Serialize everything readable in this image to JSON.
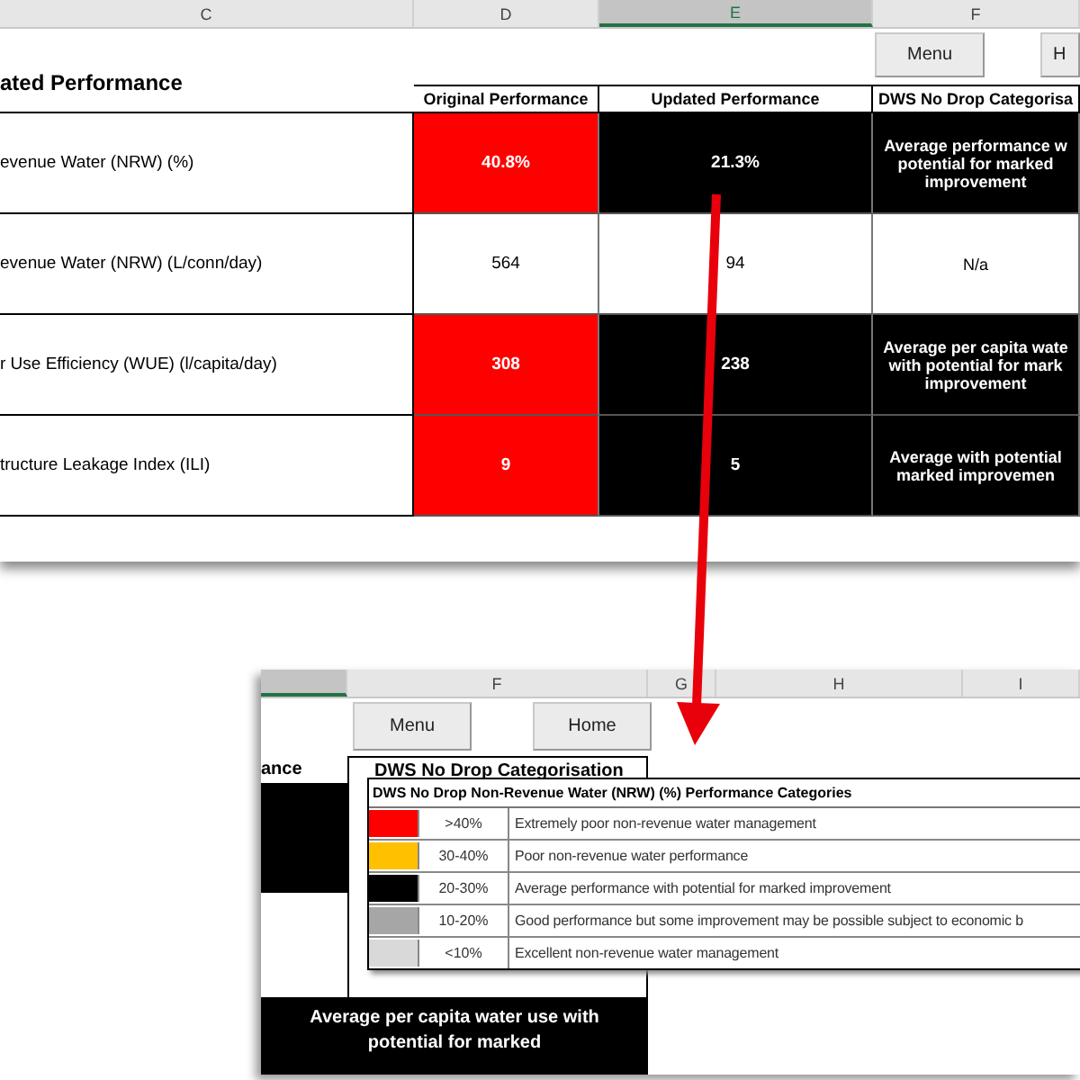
{
  "top_sheet": {
    "column_headers": [
      {
        "label": "C",
        "selected": false
      },
      {
        "label": "D",
        "selected": false
      },
      {
        "label": "E",
        "selected": true
      },
      {
        "label": "F",
        "selected": false
      }
    ],
    "buttons": [
      "Menu",
      "H"
    ],
    "title": "ated Performance",
    "table": {
      "columns": [
        "Original Performance",
        "Updated Performance",
        "DWS No Drop Categorisa"
      ],
      "rows": [
        {
          "indicator": "evenue Water (NRW) (%)",
          "original": {
            "text": "40.8%",
            "color": "#ff0000"
          },
          "updated": {
            "text": "21.3%",
            "color": "#000000"
          },
          "category": {
            "text": "Average performance w potential for marked improvement",
            "color": "#000000"
          }
        },
        {
          "indicator": "evenue Water (NRW) (L/conn/day)",
          "original": {
            "text": "564",
            "color": "#ffffff"
          },
          "updated": {
            "text": "94",
            "color": "#ffffff"
          },
          "category": {
            "text": "N/a",
            "color": "#ffffff"
          }
        },
        {
          "indicator": "r Use Efficiency (WUE) (l/capita/day)",
          "original": {
            "text": "308",
            "color": "#ff0000"
          },
          "updated": {
            "text": "238",
            "color": "#000000"
          },
          "category": {
            "text": "Average per capita wate with potential for mark improvement",
            "color": "#000000"
          }
        },
        {
          "indicator": "tructure Leakage Index (ILI)",
          "original": {
            "text": "9",
            "color": "#ff0000"
          },
          "updated": {
            "text": "5",
            "color": "#000000"
          },
          "category": {
            "text": "Average with potential marked improvemen",
            "color": "#000000"
          }
        }
      ]
    }
  },
  "bottom_sheet": {
    "column_headers": [
      {
        "label": "F",
        "selected": false
      },
      {
        "label": "G",
        "selected": false
      },
      {
        "label": "H",
        "selected": false
      },
      {
        "label": "I",
        "selected": false
      }
    ],
    "buttons": [
      "Menu",
      "Home"
    ],
    "header_cells": [
      "ance",
      "DWS No Drop Categorisation"
    ],
    "category_cell": "Average per capita water use with potential for marked",
    "legend": {
      "title": "DWS No Drop Non-Revenue Water (NRW) (%) Performance Categories",
      "rows": [
        {
          "range": ">40%",
          "description": "Extremely poor non-revenue water management",
          "color": "#ff0000"
        },
        {
          "range": "30-40%",
          "description": "Poor non-revenue water performance",
          "color": "#ffc000"
        },
        {
          "range": "20-30%",
          "description": "Average performance with potential for marked improvement",
          "color": "#000000"
        },
        {
          "range": "10-20%",
          "description": "Good performance but some improvement may be possible subject to economic b",
          "color": "#a6a6a6"
        },
        {
          "range": "<10%",
          "description": "Excellent non-revenue water management",
          "color": "#d9d9d9"
        }
      ]
    }
  }
}
